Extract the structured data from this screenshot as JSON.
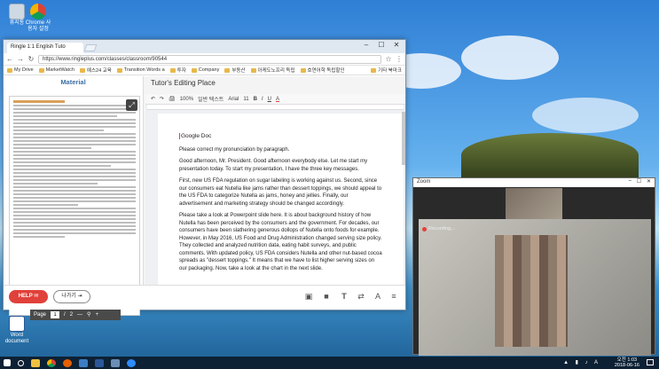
{
  "desktop": {
    "icons": [
      {
        "label": "휴지통"
      },
      {
        "label": "Chrome 사용자 설정"
      },
      {
        "label": "Word document"
      }
    ]
  },
  "browser": {
    "tab_title": "Ringle 1:1 English Tuto",
    "window_controls": {
      "minimize": "–",
      "maximize": "☐",
      "close": "✕"
    },
    "url": "https://www.ringleplus.com/classes/classroom/90544",
    "bookmarks": [
      "My Drive",
      "MarketWatch",
      "예스24 교육",
      "Transition Words a",
      "투자",
      "Company",
      "부동산",
      "아케도노프리 독립",
      "호연어학 독립할인",
      "기타 북마크"
    ]
  },
  "app": {
    "material_title": "Material",
    "editor_title": "Tutor's Editing Place",
    "pager": {
      "label": "Page",
      "current": "1",
      "separator": "/",
      "total": "2"
    },
    "help_button": "HELP",
    "exit_button": "나가기"
  },
  "gdoc": {
    "toolbar": [
      "↶",
      "↷",
      "🖨",
      "100%",
      "일반 텍스트",
      "Arial",
      "11",
      "B",
      "I",
      "U",
      "A"
    ],
    "doc_title": "Google Doc",
    "paragraphs": [
      "Please correct my pronunciation by paragraph.",
      "Good afternoon, Mr. President. Good afternoon everybody else. Let me start my presentation today. To start my presentation, I have the three key messages.",
      "First, new US FDA regulation on sugar labeling is working against us. Second, since our consumers eat Nutella like jams rather than dessert toppings, we should appeal to the US FDA to categorize Nutella as jams, honey and jellies. Finally, our advertisement and marketing strategy should be changed accordingly.",
      "Please take a look at Powerpoint slide here. It is about background history of how Nutella has been perceived by the consumers and the government. For decades, our consumers have been slathering generous dollops of Nutella onto foods for example. However, in May 2016, US Food and Drug Administration changed serving size policy. They collected and analyzed nutrition data, eating habit surveys, and public comments. With updated policy, US FDA considers Nutella and other nut-based cocoa spreads as \"dessert toppings.\" It means that we have to list higher serving sizes on our packaging. Now, take a look at the chart in the next slide."
    ]
  },
  "zoom": {
    "title": "Zoom",
    "recording": "Recording..."
  },
  "taskbar": {
    "time": "오전 1:03",
    "date": "2018-06-16"
  },
  "colors": {
    "accent": "#3b6ea5",
    "help": "#e0413a",
    "taskbar": "#0d2134"
  }
}
